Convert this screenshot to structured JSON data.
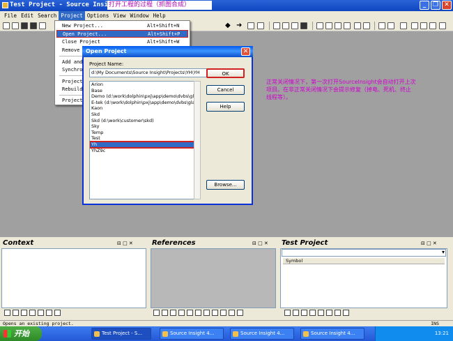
{
  "titlebar": {
    "title": "Test Project - Source Insight",
    "overlay_note": "打开工程的过程（抓图合成）"
  },
  "menubar": [
    "File",
    "Edit",
    "Search",
    "Project",
    "Options",
    "View",
    "Window",
    "Help"
  ],
  "project_menu": [
    {
      "label": "New Project...",
      "shortcut": "Alt+Shift+N"
    },
    {
      "label": "Open Project...",
      "shortcut": "Alt+Shift+P"
    },
    {
      "label": "Close Project",
      "shortcut": "Alt+Shift+W"
    },
    {
      "label": "Remove",
      "shortcut": ""
    },
    {
      "label": "Add and",
      "shortcut": ""
    },
    {
      "label": "Synchro",
      "shortcut": ""
    },
    {
      "label": "Project",
      "shortcut": ""
    },
    {
      "label": "Rebuild",
      "shortcut": ""
    },
    {
      "label": "Project",
      "shortcut": ""
    }
  ],
  "dialog": {
    "title": "Open Project",
    "label": "Project Name:",
    "input_value": "d:\\My Documents\\Source Insight\\Projects\\YH\\YH",
    "projects": [
      "Arion",
      "Base",
      "Demo (d:\\work\\dolphin\\pxj\\app\\demo\\dvbs\\glas",
      "E-tek (d:\\work\\dolphin\\pxj\\app\\demo\\dvbs\\glas",
      "Kaon",
      "Skd",
      "Skd (d:\\work\\customer\\skd)",
      "Sky",
      "Temp",
      "Test",
      "Yh",
      "YhZ9c"
    ],
    "selected": "Yh",
    "ok": "OK",
    "cancel": "Cancel",
    "help": "Help",
    "browse": "Browse..."
  },
  "note": "正常关闭情况下，第一次打开SourceInsight会自动打开上次项目。在非正常关闭情况下会提示修复（掉电、死机、终止线程等）。",
  "panes": {
    "context": "Context",
    "references": "References",
    "test_project": "Test Project",
    "symbol_header": "Symbol"
  },
  "statusbar": {
    "text": "Opens an existing project.",
    "ins": "INS"
  },
  "taskbar": {
    "start": "开始",
    "tasks": [
      "Test Project - S...",
      "Source Insight 4...",
      "Source Insight 4...",
      "Source Insight 4..."
    ],
    "clock": "13:21"
  }
}
